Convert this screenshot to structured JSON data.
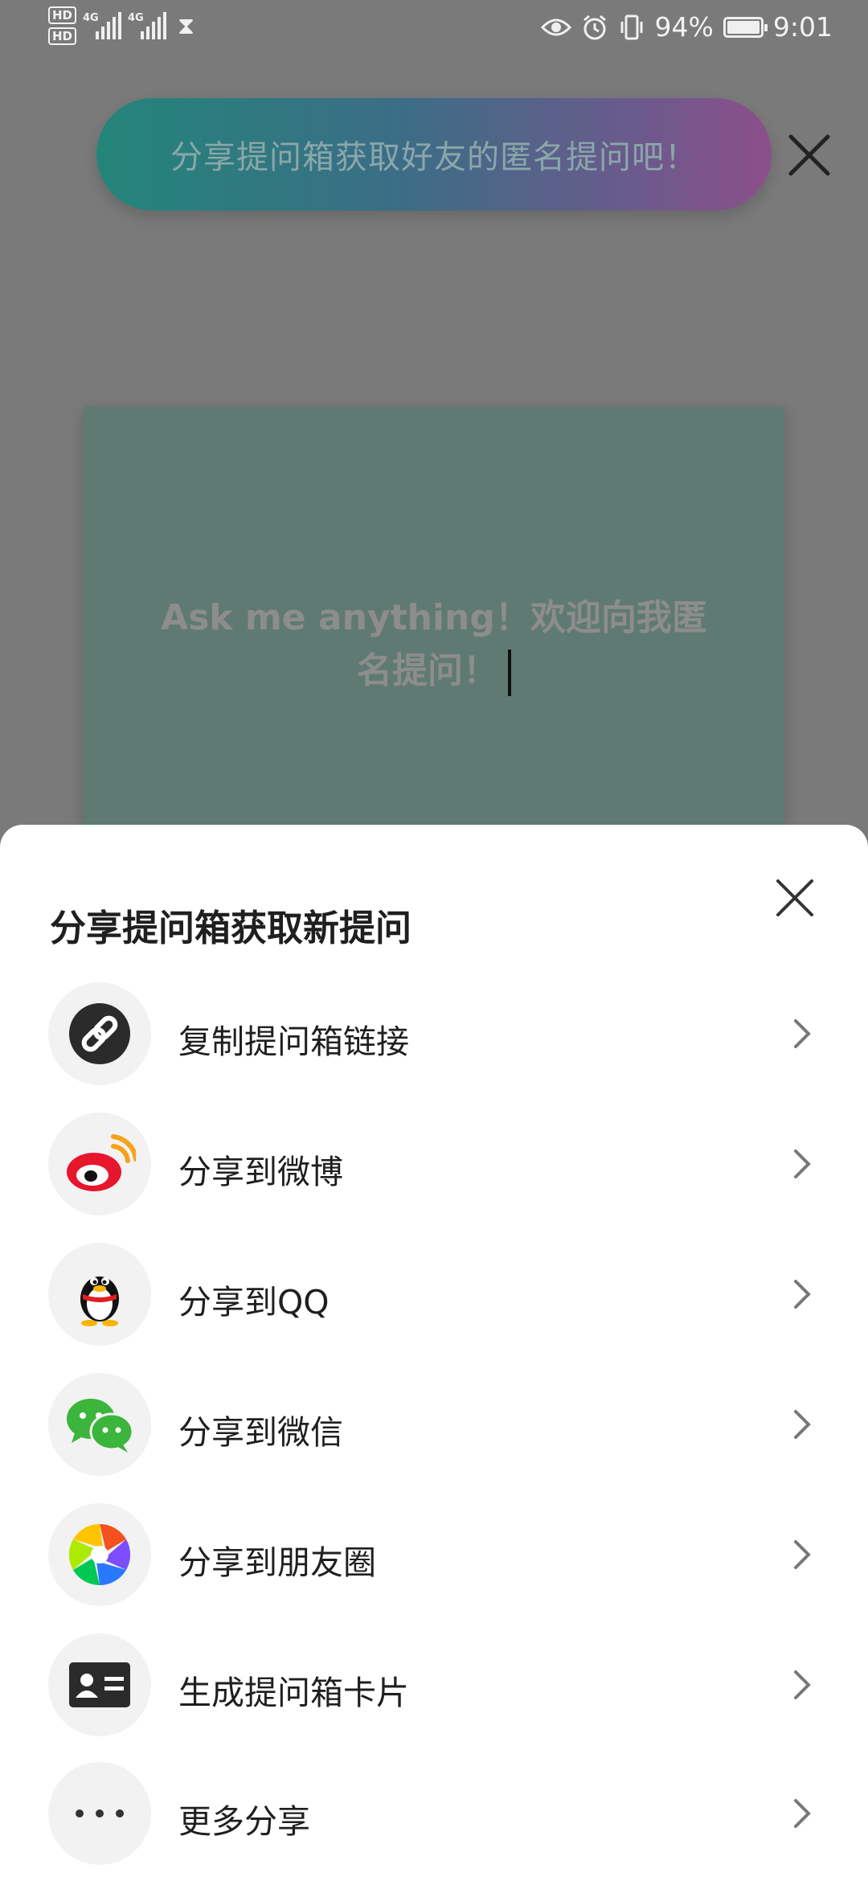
{
  "status_bar": {
    "hd1": "HD",
    "hd2": "HD",
    "net1": "4G",
    "net2": "4G",
    "battery": "94%",
    "time": "9:01"
  },
  "banner": {
    "text": "分享提问箱获取好友的匿名提问吧！"
  },
  "card": {
    "line1": "Ask me anything！欢迎向我匿",
    "line2": "名提问！"
  },
  "sheet": {
    "title": "分享提问箱获取新提问",
    "items": [
      {
        "label": "复制提问箱链接",
        "icon": "link-icon"
      },
      {
        "label": "分享到微博",
        "icon": "weibo-icon"
      },
      {
        "label": "分享到QQ",
        "icon": "qq-icon"
      },
      {
        "label": "分享到微信",
        "icon": "wechat-icon"
      },
      {
        "label": "分享到朋友圈",
        "icon": "moments-icon"
      },
      {
        "label": "生成提问箱卡片",
        "icon": "card-icon"
      },
      {
        "label": "更多分享",
        "icon": "more-icon"
      }
    ]
  },
  "colors": {
    "overlay": "#7a7a7a",
    "card": "#5f7a72",
    "banner_start": "#23857a",
    "banner_end": "#8c4f8a"
  }
}
